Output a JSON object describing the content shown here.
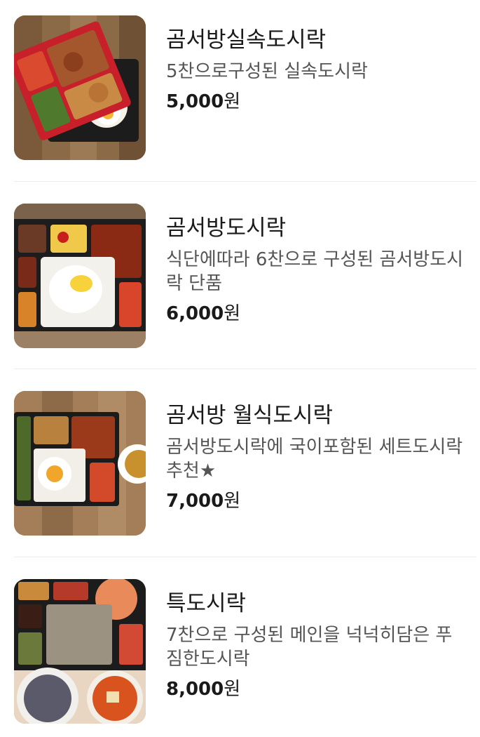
{
  "menu": {
    "items": [
      {
        "name": "곰서방실속도시락",
        "description": "5찬으로구성된 실속도시락",
        "price_amount": "5,000",
        "price_unit": "원"
      },
      {
        "name": "곰서방도시락",
        "description": "식단에따라 6찬으로 구성된 곰서방도시락 단품",
        "price_amount": "6,000",
        "price_unit": "원"
      },
      {
        "name": "곰서방 월식도시락",
        "description": "곰서방도시락에 국이포함된 세트도시락 추천★",
        "price_amount": "7,000",
        "price_unit": "원"
      },
      {
        "name": "특도시락",
        "description": "7찬으로 구성된 메인을 넉넉히담은 푸짐한도시락",
        "price_amount": "8,000",
        "price_unit": "원"
      }
    ]
  },
  "colors": {
    "background": "#ffffff",
    "title_text": "#1a1a1a",
    "description_text": "#555555",
    "divider": "#ececec"
  }
}
